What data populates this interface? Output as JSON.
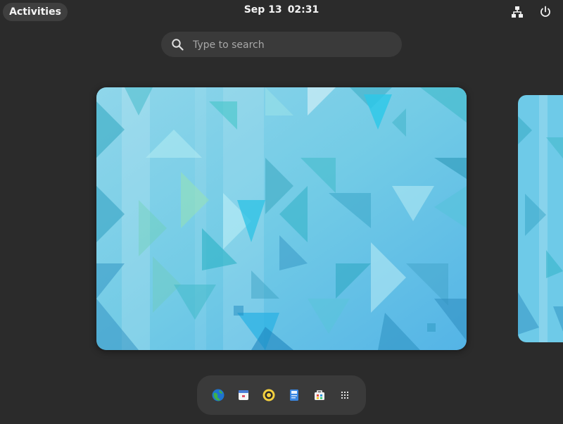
{
  "topbar": {
    "activities_label": "Activities",
    "date": "Sep 13",
    "time": "02:31",
    "tray": {
      "network_icon": "network-icon",
      "power_icon": "power-icon"
    }
  },
  "search": {
    "placeholder": "Type to search",
    "value": ""
  },
  "workspaces": {
    "wallpaper": "blue-geometric-triangles",
    "count": 2
  },
  "dash": {
    "apps": [
      {
        "icon": "browser-globe-icon"
      },
      {
        "icon": "calendar-icon"
      },
      {
        "icon": "music-player-icon"
      },
      {
        "icon": "document-editor-icon"
      },
      {
        "icon": "software-store-icon"
      },
      {
        "icon": "show-apps-grid-icon"
      }
    ]
  },
  "colors": {
    "background": "#2b2b2b",
    "panel": "#3a3a3a",
    "wallpaper_base": "#6cc7e6",
    "wallpaper_accent": "#3bb8c9"
  }
}
